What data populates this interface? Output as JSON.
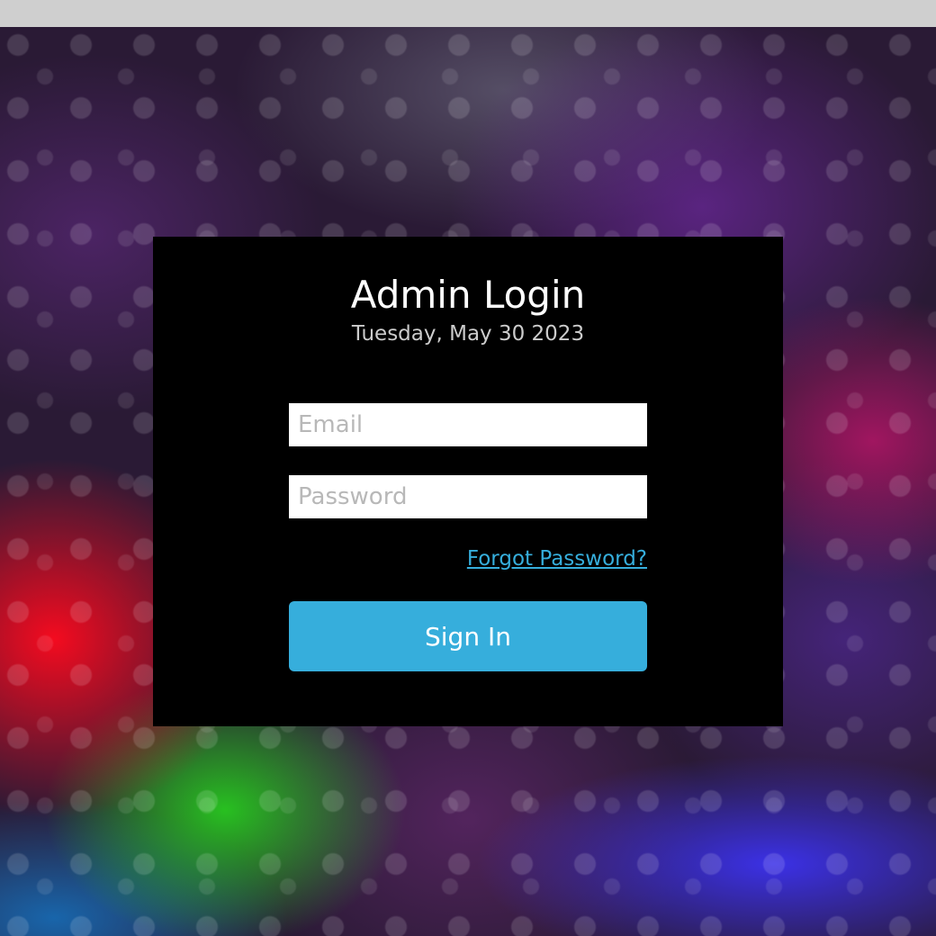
{
  "colors": {
    "top_bar": "#cfcfcf",
    "card_background": "#000000",
    "accent": "#36aedc",
    "title_text": "#ffffff",
    "date_text": "#cccccc",
    "placeholder_text": "#b8b8b8"
  },
  "login": {
    "title": "Admin Login",
    "date": "Tuesday, May 30 2023",
    "email": {
      "value": "",
      "placeholder": "Email"
    },
    "password": {
      "value": "",
      "placeholder": "Password"
    },
    "forgot_label": "Forgot Password?",
    "signin_label": "Sign In"
  }
}
